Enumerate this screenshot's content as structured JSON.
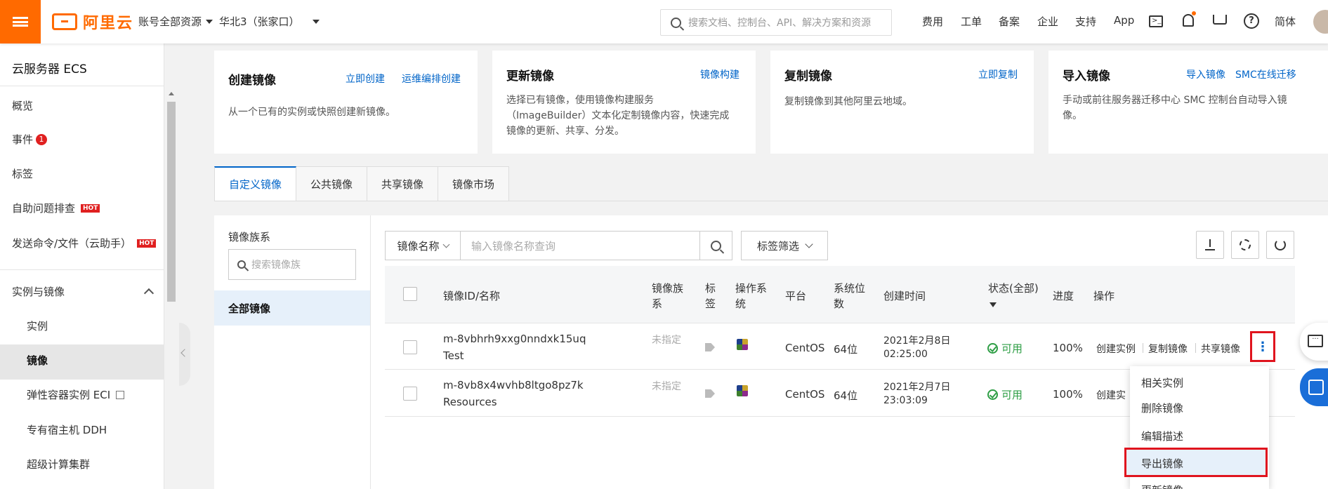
{
  "topbar": {
    "logo_text": "阿里云",
    "resource_scope": "账号全部资源",
    "region": "华北3（张家口）",
    "search_placeholder": "搜索文档、控制台、API、解决方案和资源",
    "nav": [
      "费用",
      "工单",
      "备案",
      "企业",
      "支持",
      "App"
    ],
    "language": "简体",
    "brand_color": "#ff6a00"
  },
  "sidebar": {
    "title": "云服务器 ECS",
    "items": [
      {
        "label": "概览"
      },
      {
        "label": "事件",
        "badge": "1"
      },
      {
        "label": "标签"
      },
      {
        "label": "自助问题排查",
        "hot": "HOT"
      },
      {
        "label": "发送命令/文件（云助手）",
        "hot": "HOT"
      }
    ],
    "group": {
      "label": "实例与镜像",
      "items": [
        "实例",
        "镜像",
        "弹性容器实例 ECI",
        "专有宿主机 DDH",
        "超级计算集群"
      ]
    }
  },
  "cards": [
    {
      "title": "创建镜像",
      "links": [
        "立即创建",
        "运维编排创建"
      ],
      "desc": "从一个已有的实例或快照创建新镜像。"
    },
    {
      "title": "更新镜像",
      "links": [
        "镜像构建"
      ],
      "desc_lines": [
        "选择已有镜像，使用镜像构建服务",
        "（ImageBuilder）文本化定制镜像内容，快速完成",
        "镜像的更新、共享、分发。"
      ]
    },
    {
      "title": "复制镜像",
      "links": [
        "立即复制"
      ],
      "desc": "复制镜像到其他阿里云地域。"
    },
    {
      "title": "导入镜像",
      "links": [
        "导入镜像",
        "SMC在线迁移"
      ],
      "desc_lines": [
        "手动或前往服务器迁移中心 SMC 控制台自动导入镜",
        "像。"
      ]
    }
  ],
  "tabs": [
    "自定义镜像",
    "公共镜像",
    "共享镜像",
    "镜像市场"
  ],
  "family": {
    "title": "镜像族系",
    "search_placeholder": "搜索镜像族",
    "selected": "全部镜像"
  },
  "filter": {
    "field": "镜像名称",
    "placeholder": "输入镜像名称查询",
    "tag_filter": "标签筛选"
  },
  "table": {
    "headers": {
      "id_name": "镜像ID/名称",
      "family": [
        "镜像族",
        "系"
      ],
      "tag": [
        "标",
        "签"
      ],
      "os": [
        "操作系",
        "统"
      ],
      "platform": "平台",
      "bits": [
        "系统位",
        "数"
      ],
      "created": "创建时间",
      "status": "状态(全部)",
      "progress": "进度",
      "actions": "操作"
    },
    "rows": [
      {
        "id": "m-8vbhrh9xxg0nndxk15uq",
        "name": "Test",
        "family": "未指定",
        "platform": "CentOS",
        "bits": "64位",
        "date": "2021年2月8日",
        "time": "02:25:00",
        "status": "可用",
        "progress": "100%",
        "actions": [
          "创建实例",
          "复制镜像",
          "共享镜像"
        ]
      },
      {
        "id": "m-8vb8x4wvhb8ltgo8pz7k",
        "name": "Resources",
        "family": "未指定",
        "platform": "CentOS",
        "bits": "64位",
        "date": "2021年2月7日",
        "time": "23:03:09",
        "status": "可用",
        "progress": "100%",
        "actions": [
          "创建实"
        ]
      }
    ]
  },
  "dropdown": [
    "相关实例",
    "删除镜像",
    "编辑描述",
    "导出镜像",
    "更新镜像"
  ]
}
